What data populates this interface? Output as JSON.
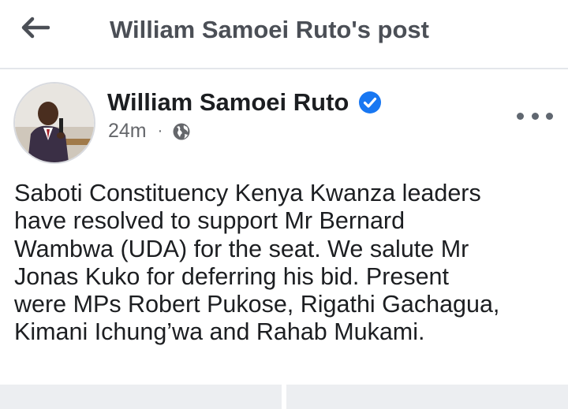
{
  "header": {
    "title": "William Samoei Ruto's post"
  },
  "post": {
    "author": "William Samoei Ruto",
    "verified_icon": "verified-check-icon",
    "time": "24m",
    "separator": "·",
    "audience_icon": "globe-icon",
    "more_icon": "more-options-icon",
    "text": "Saboti Constituency Kenya Kwanza leaders\nhave resolved to support Mr Bernard\nWambwa (UDA) for the seat. We salute Mr\nJonas Kuko for deferring his bid. Present\nwere MPs Robert Pukose, Rigathi Gachagua,\nKimani Ichung’wa and Rahab Mukami."
  },
  "colors": {
    "verified": "#1877f2",
    "header_text": "#4b4f56",
    "meta_text": "#65676b",
    "action_bar": "#eceef1"
  }
}
